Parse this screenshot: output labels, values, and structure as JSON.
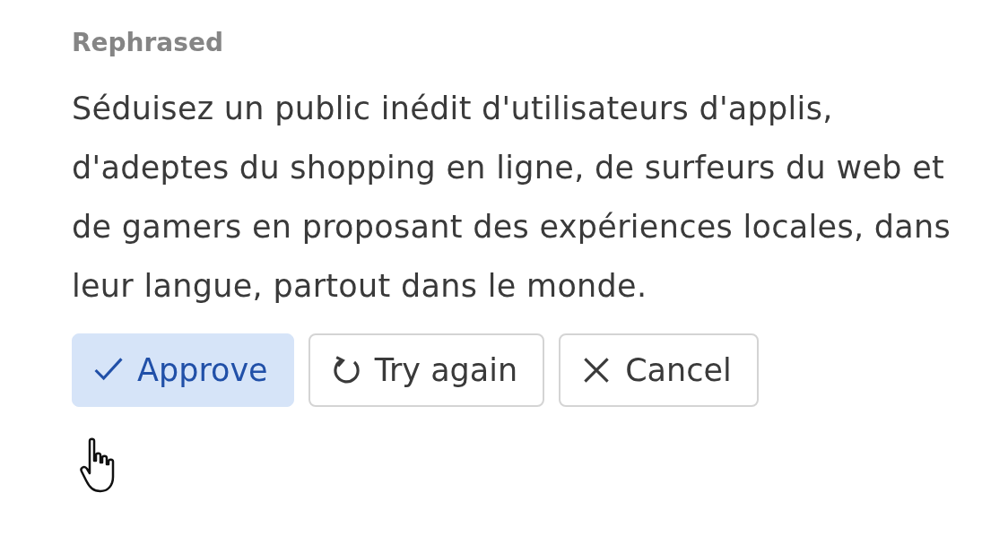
{
  "label": "Rephrased",
  "text": "Séduisez un public inédit d'utilisateurs d'applis, d'adeptes du shopping en ligne, de surfeurs du web et de gamers en proposant des expériences locales, dans leur langue, partout dans le monde.",
  "buttons": [
    {
      "label": "Approve",
      "kind": "primary"
    },
    {
      "label": "Try again",
      "kind": "outline"
    },
    {
      "label": "Cancel",
      "kind": "outline"
    }
  ]
}
